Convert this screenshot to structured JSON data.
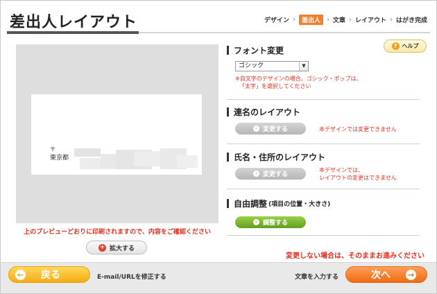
{
  "header": {
    "title": "差出人レイアウト",
    "steps": [
      {
        "label": "デザイン",
        "active": false
      },
      {
        "label": "差出人",
        "active": true
      },
      {
        "label": "文章",
        "active": false
      },
      {
        "label": "レイアウト",
        "active": false
      },
      {
        "label": "はがき完成",
        "active": false
      }
    ],
    "step_separator": "›"
  },
  "help": {
    "label": "ヘルプ",
    "icon": "question-icon"
  },
  "preview": {
    "postal_mark": "〒",
    "address_line": "東京都",
    "note": "上のプレビューどおりに印刷されますので、内容をご確認ください",
    "zoom_label": "拡大する"
  },
  "sections": {
    "font": {
      "heading": "フォント変更",
      "selected": "ゴシック",
      "warning_line1": "※自文字のデザインの場合、ゴシック・ポップは、",
      "warning_line2": "「太字」を選択してください"
    },
    "joint": {
      "heading": "連名のレイアウト",
      "button": "変更する",
      "note": "本デザインでは変更できません"
    },
    "name_address": {
      "heading": "氏名・住所のレイアウト",
      "button": "変更する",
      "note_line1": "本デザインでは、",
      "note_line2": "レイアウトの変更はできません"
    },
    "free": {
      "heading": "自由調整",
      "sub": "(項目の位置・大きさ)",
      "button": "調整する"
    },
    "proceed_note": "変更しない場合は、そのままお進みください"
  },
  "footer": {
    "back_label": "戻る",
    "fix_link": "E-mail/URLを修正する",
    "text_link": "文章を入力する",
    "next_label": "次へ"
  },
  "colors": {
    "accent": "#f08032",
    "warning": "#e0301e",
    "green": "#6aa32a",
    "back_button": "#f6ab14",
    "next_button": "#ef6a12"
  }
}
